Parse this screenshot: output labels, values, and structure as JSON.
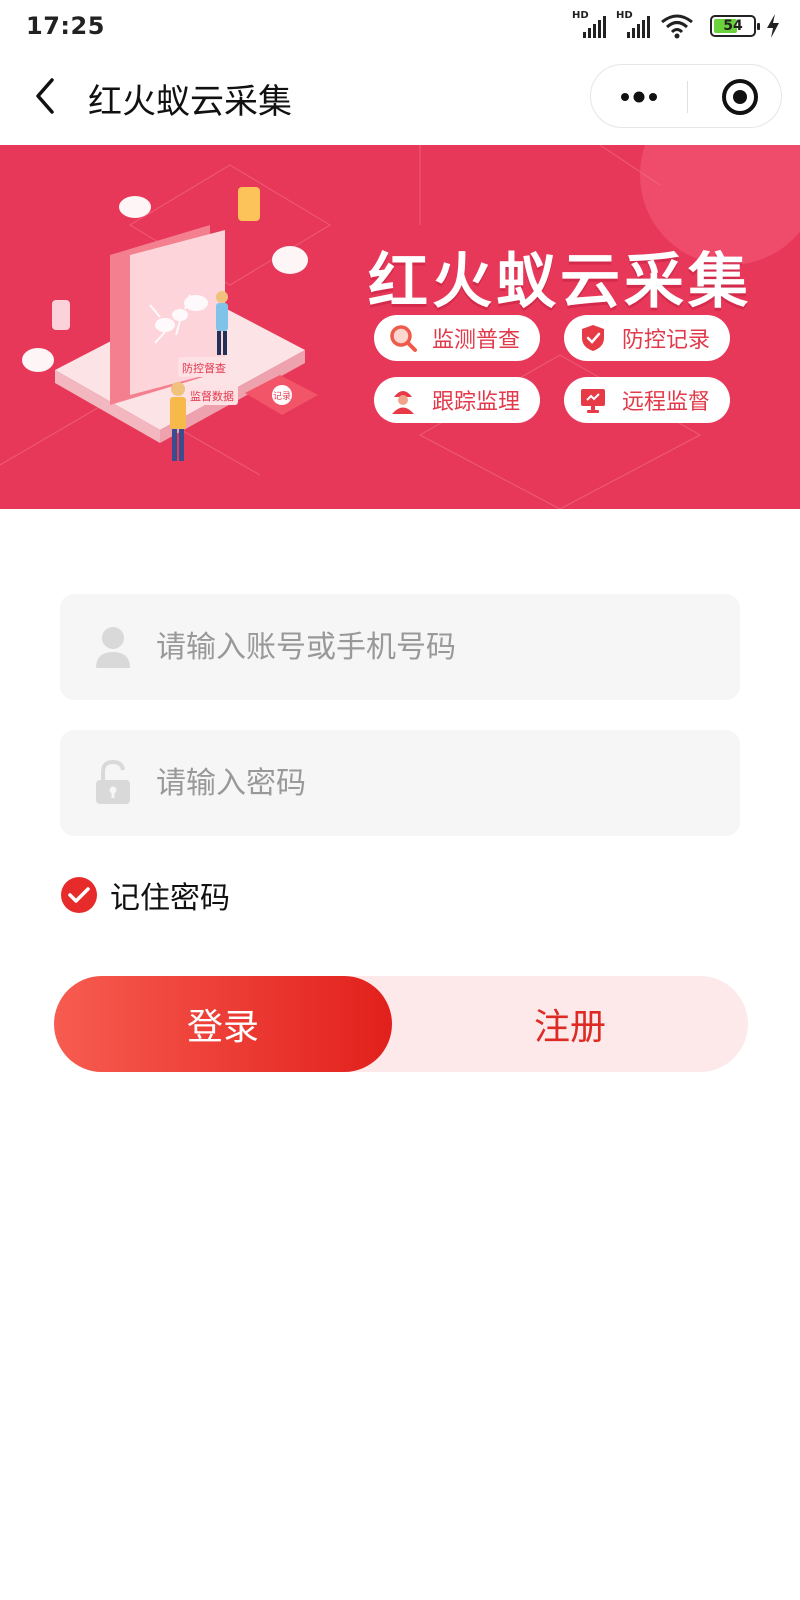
{
  "status_bar": {
    "time": "17:25",
    "signal1_label": "HD",
    "signal2_label": "HD",
    "battery_level": "54",
    "icons": [
      "signal-icon",
      "signal-icon",
      "wifi-icon",
      "battery-icon",
      "charging-icon"
    ]
  },
  "nav": {
    "title": "红火蚁云采集",
    "icons": [
      "back-icon",
      "more-icon",
      "target-icon"
    ]
  },
  "banner": {
    "title": "红火蚁云采集",
    "features": [
      {
        "label": "监测普查",
        "icon": "search-icon"
      },
      {
        "label": "防控记录",
        "icon": "shield-icon"
      },
      {
        "label": "跟踪监理",
        "icon": "worker-icon"
      },
      {
        "label": "远程监督",
        "icon": "monitor-icon"
      }
    ],
    "illustration_tags": [
      "防控督查",
      "监督数据",
      "记录"
    ]
  },
  "form": {
    "account_placeholder": "请输入账号或手机号码",
    "account_value": "",
    "password_placeholder": "请输入密码",
    "password_value": "",
    "remember_label": "记住密码",
    "remember_checked": true
  },
  "buttons": {
    "login_label": "登录",
    "register_label": "注册"
  },
  "colors": {
    "brand_red": "#e2201c",
    "banner_bg": "#e8385a",
    "field_bg": "#f6f6f6",
    "register_bg": "#fde9ea"
  }
}
